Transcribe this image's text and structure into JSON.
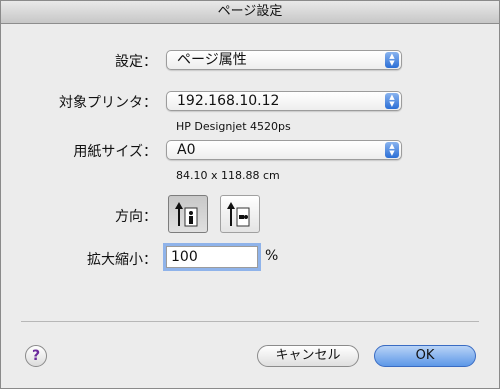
{
  "window": {
    "title": "ページ設定"
  },
  "settings": {
    "label": "設定：",
    "value": "ページ属性"
  },
  "printer": {
    "label": "対象プリンタ：",
    "value": "192.168.10.12",
    "model": "HP Designjet 4520ps"
  },
  "paper": {
    "label": "用紙サイズ：",
    "value": "A0",
    "dimensions": "84.10 x 118.88 cm"
  },
  "orientation": {
    "label": "方向：",
    "selected": "portrait"
  },
  "scale": {
    "label": "拡大縮小：",
    "value": "100",
    "unit": "%"
  },
  "buttons": {
    "help": "?",
    "cancel": "キャンセル",
    "ok": "OK"
  },
  "colors": {
    "accent": "#5d98e8",
    "focus_ring": "#8fb3ea"
  },
  "icons": [
    "popup-arrows-icon",
    "portrait-orientation-icon",
    "landscape-orientation-icon",
    "help-icon"
  ]
}
